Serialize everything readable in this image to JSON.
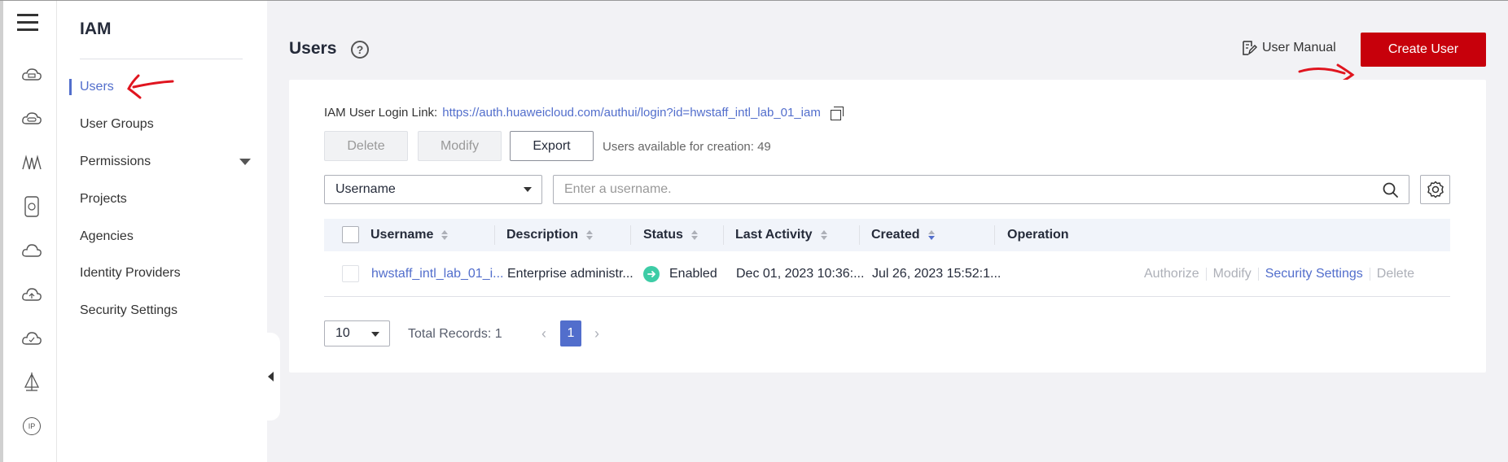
{
  "rail": {
    "icons": [
      "cloud-server-icon",
      "cloud-storage-icon",
      "network-wave-icon",
      "device-icon",
      "cloud-icon",
      "cloud-upload-icon",
      "cloud-check-icon",
      "sail-icon",
      "ip-icon"
    ],
    "ip_label": "IP"
  },
  "sidebar": {
    "title": "IAM",
    "items": [
      {
        "label": "Users",
        "active": true
      },
      {
        "label": "User Groups"
      },
      {
        "label": "Permissions",
        "expandable": true
      },
      {
        "label": "Projects"
      },
      {
        "label": "Agencies"
      },
      {
        "label": "Identity Providers"
      },
      {
        "label": "Security Settings"
      }
    ]
  },
  "header": {
    "title": "Users",
    "help_icon": "?",
    "manual_label": "User Manual",
    "create_label": "Create User"
  },
  "login": {
    "label": "IAM User Login Link:",
    "url": "https://auth.huaweicloud.com/authui/login?id=hwstaff_intl_lab_01_iam"
  },
  "toolbar": {
    "delete_label": "Delete",
    "modify_label": "Modify",
    "export_label": "Export",
    "available_text": "Users available for creation: 49"
  },
  "filter": {
    "field_value": "Username",
    "search_placeholder": "Enter a username."
  },
  "table": {
    "columns": [
      "Username",
      "Description",
      "Status",
      "Last Activity",
      "Created",
      "Operation"
    ],
    "rows": [
      {
        "username": "hwstaff_intl_lab_01_i...",
        "description": "Enterprise administr...",
        "status": "Enabled",
        "last_activity": "Dec 01, 2023 10:36:...",
        "created": "Jul 26, 2023 15:52:1...",
        "operations": [
          "Authorize",
          "Modify",
          "Security Settings",
          "Delete"
        ]
      }
    ]
  },
  "pagination": {
    "page_size": "10",
    "total": "Total Records: 1",
    "current_page": "1"
  },
  "colors": {
    "brand_red": "#c7000b",
    "link_blue": "#526ecc",
    "status_green": "#3dcca6",
    "annotation_red": "#e0151f"
  }
}
